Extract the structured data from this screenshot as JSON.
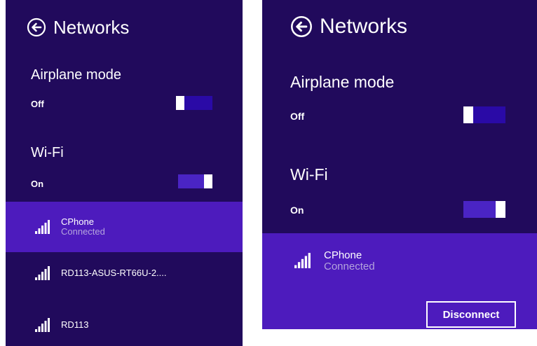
{
  "colors": {
    "panel_bg": "#210a5c",
    "selected_bg": "#4d1bbd",
    "toggle_track_off": "#2a0aa6",
    "toggle_track_on": "#4a24c4",
    "thumb": "#ffffff",
    "status_text": "#b4a4dd"
  },
  "left": {
    "header": {
      "title": "Networks",
      "back_icon": "back-arrow-circle-icon"
    },
    "airplane": {
      "label": "Airplane mode",
      "state": "Off",
      "on": false
    },
    "wifi": {
      "label": "Wi-Fi",
      "state": "On",
      "on": true
    },
    "networks": [
      {
        "name": "CPhone",
        "status": "Connected",
        "icon": "wifi-signal-icon",
        "selected": true
      },
      {
        "name": "RD113-ASUS-RT66U-2....",
        "icon": "wifi-signal-icon",
        "selected": false
      },
      {
        "name": "RD113",
        "icon": "wifi-signal-icon",
        "selected": false
      }
    ]
  },
  "right": {
    "header": {
      "title": "Networks",
      "back_icon": "back-arrow-circle-icon"
    },
    "airplane": {
      "label": "Airplane mode",
      "state": "Off",
      "on": false
    },
    "wifi": {
      "label": "Wi-Fi",
      "state": "On",
      "on": true
    },
    "networks": [
      {
        "name": "CPhone",
        "status": "Connected",
        "icon": "wifi-signal-icon",
        "selected": true
      }
    ],
    "disconnect_label": "Disconnect"
  }
}
